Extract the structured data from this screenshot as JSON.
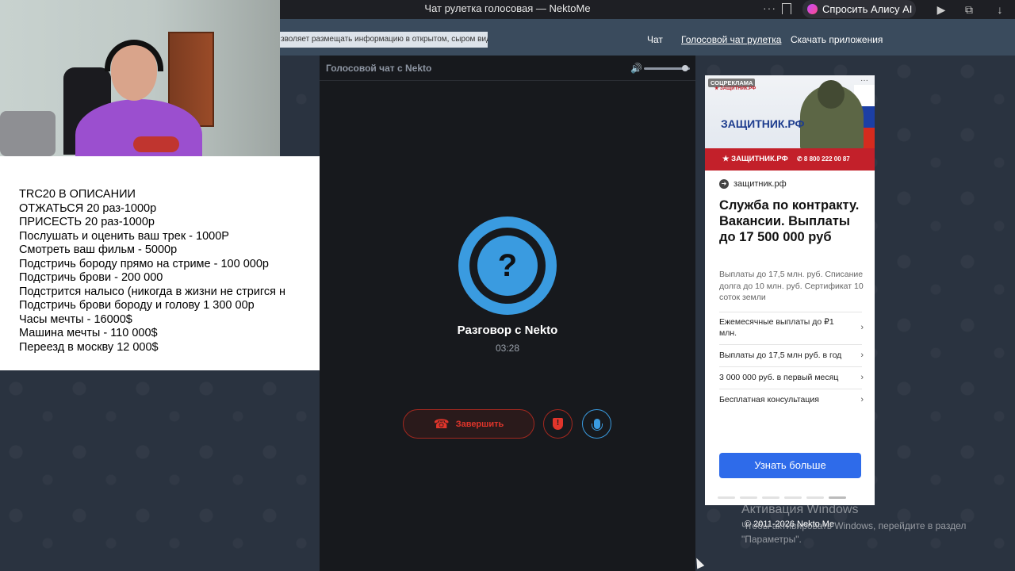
{
  "browser": {
    "title": "Чат рулетка голосовая — NektoMe",
    "alice_label": "Спросить Алису AI",
    "menu_dots": "···"
  },
  "header": {
    "notice": "зволяет размещать информацию в открытом, сыром виде!",
    "nav": [
      "Чат",
      "Голосовой чат рулетка",
      "Скачать приложения"
    ],
    "active_nav": "Голосовой чат рулетка"
  },
  "overlay": {
    "lines": [
      "TRC20 В ОПИСАНИИ",
      "ОТЖАТЬСЯ 20 раз-1000р",
      "ПРИСЕСТЬ 20 раз-1000р",
      "Послушать и оценить ваш трек - 1000Р",
      "Смотреть ваш фильм - 5000р",
      "Подстричь бороду прямо на стриме - 100 000р",
      "Подстричь брови - 200 000",
      "Подстрится налысо (никогда в жизни не стригся н",
      "Подстричь брови бороду и голову 1 300 00р",
      "Часы мечты - 16000$",
      "Машина мечты - 110 000$",
      "Переезд в москву 12 000$"
    ]
  },
  "chat": {
    "panel_title": "Голосовой чат с Nekto",
    "volume_icon": "🔊",
    "volume_level": 0.9,
    "avatar_symbol": "?",
    "conversation_title": "Разговор с Nekto",
    "timer": "03:28",
    "end_label": "Завершить",
    "end_icon": "☎",
    "report_icon": "!"
  },
  "ad": {
    "tag": "СОЦРЕКЛАМА",
    "more": "···",
    "logo_small": "★ ЗАЩИТНИК.РФ",
    "banner_title": "ЗАЩИТНИК.РФ",
    "banner_red_left": "★ ЗАЩИТНИК.РФ",
    "banner_phone": "✆ 8 800 222 00 87",
    "domain": "защитник.рф",
    "domain_icon": "➜",
    "headline": "Служба по контракту. Вакансии. Выплаты до 17 500 000 руб",
    "description": "Выплаты до 17,5 млн. руб. Списание долга до 10 млн. руб. Сертификат 10 соток земли",
    "items": [
      "Ежемесячные выплаты до ₽1 млн.",
      "Выплаты до 17,5 млн руб. в год",
      "3 000 000 руб. в первый месяц",
      "Бесплатная консультация"
    ],
    "arrow": "›",
    "cta": "Узнать больше"
  },
  "footer": {
    "windows_title": "Активация Windows",
    "windows_sub": "Чтобы активировать Windows, перейдите в раздел \"Параметры\".",
    "copyright": "© 2011-2026 Nekto.Me"
  }
}
